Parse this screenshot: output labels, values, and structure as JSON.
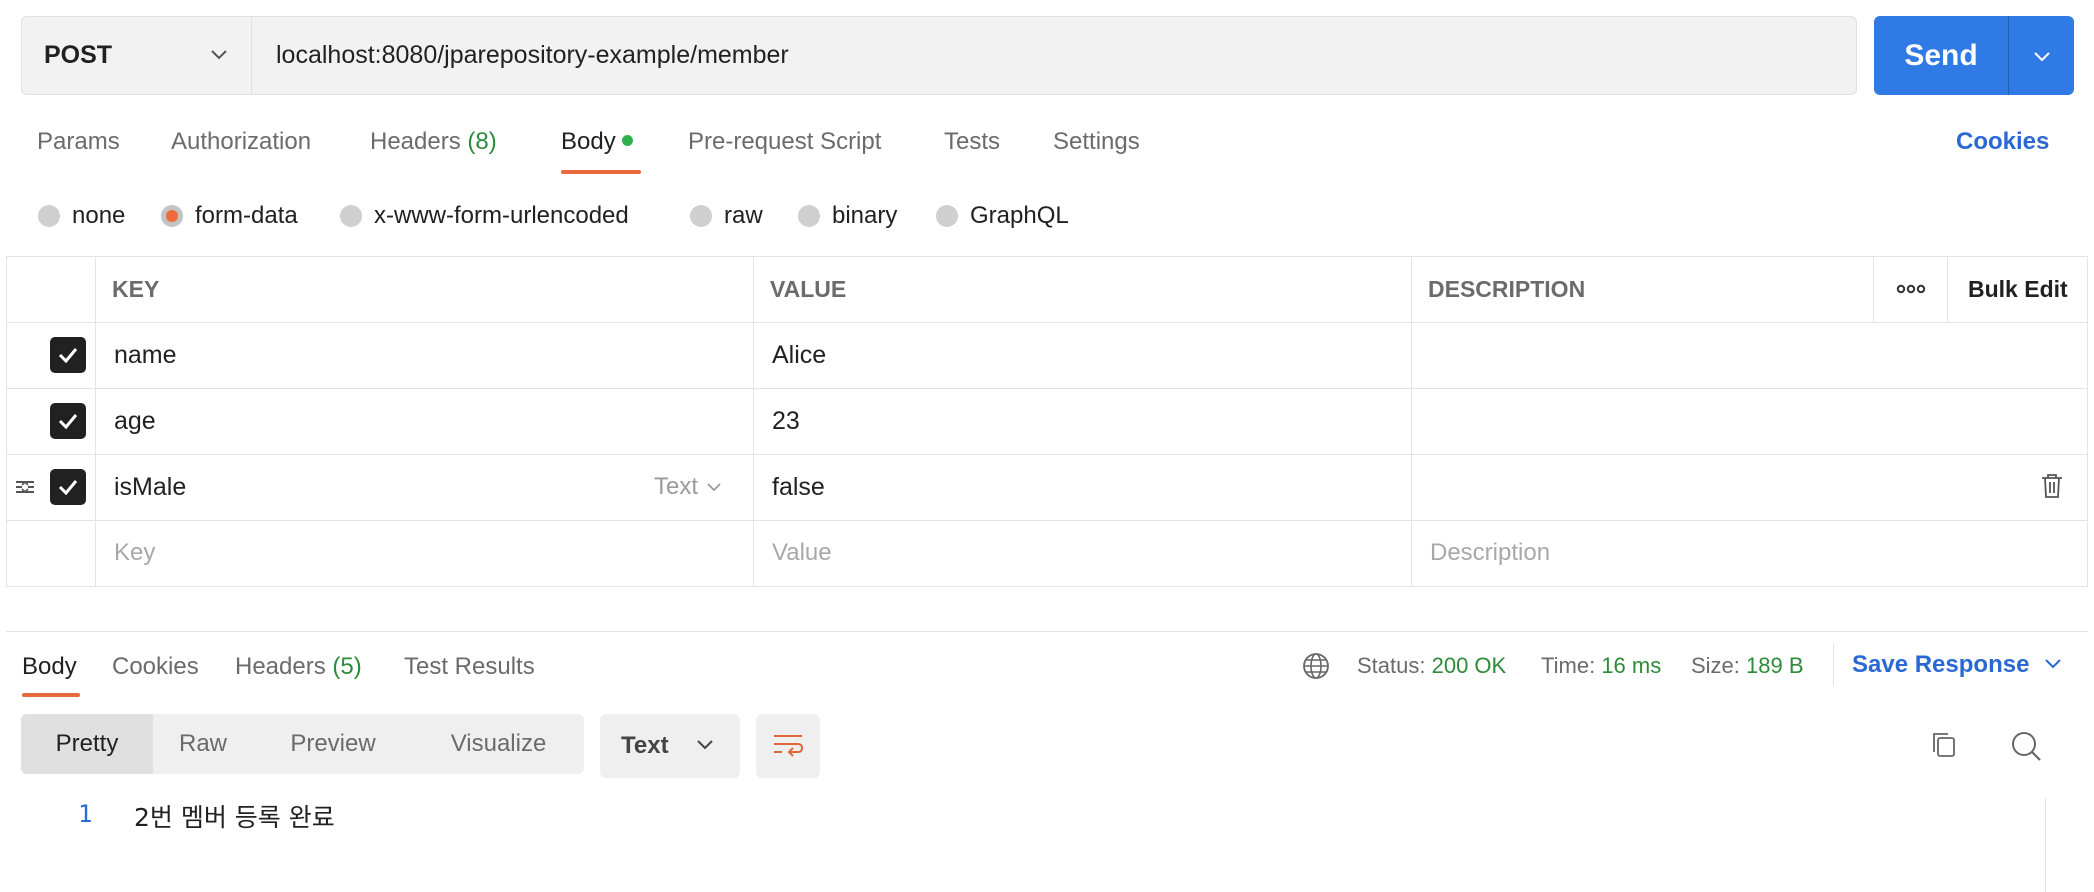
{
  "request": {
    "method": "POST",
    "url": "localhost:8080/jparepository-example/member",
    "send_label": "Send"
  },
  "request_tabs": [
    {
      "label": "Params"
    },
    {
      "label": "Authorization"
    },
    {
      "label": "Headers",
      "count": "(8)"
    },
    {
      "label": "Body"
    },
    {
      "label": "Pre-request Script"
    },
    {
      "label": "Tests"
    },
    {
      "label": "Settings"
    }
  ],
  "active_request_tab": "Body",
  "cookies_label": "Cookies",
  "body_types": [
    "none",
    "form-data",
    "x-www-form-urlencoded",
    "raw",
    "binary",
    "GraphQL"
  ],
  "selected_body_type": "form-data",
  "table": {
    "headers": {
      "key": "KEY",
      "value": "VALUE",
      "description": "DESCRIPTION",
      "bulk_edit": "Bulk Edit"
    },
    "rows": [
      {
        "key": "name",
        "value": "Alice",
        "checked": true
      },
      {
        "key": "age",
        "value": "23",
        "checked": true
      },
      {
        "key": "isMale",
        "value": "false",
        "checked": true,
        "type": "Text"
      }
    ],
    "placeholders": {
      "key": "Key",
      "value": "Value",
      "description": "Description"
    }
  },
  "response_tabs": [
    {
      "label": "Body"
    },
    {
      "label": "Cookies"
    },
    {
      "label": "Headers",
      "count": "(5)"
    },
    {
      "label": "Test Results"
    }
  ],
  "active_response_tab": "Body",
  "status": {
    "status_label": "Status:",
    "status_value": "200 OK",
    "time_label": "Time:",
    "time_value": "16 ms",
    "size_label": "Size:",
    "size_value": "189 B"
  },
  "save_response_label": "Save Response",
  "view_modes": [
    "Pretty",
    "Raw",
    "Preview",
    "Visualize"
  ],
  "active_view_mode": "Pretty",
  "format_label": "Text",
  "response_lines": [
    {
      "num": "1",
      "text": "2번 멤버 등록 완료"
    }
  ],
  "colors": {
    "accent_blue": "#2f7ae5",
    "link_blue": "#2a69d4",
    "active_orange": "#e8693b",
    "success_green": "#2e8b3a"
  }
}
